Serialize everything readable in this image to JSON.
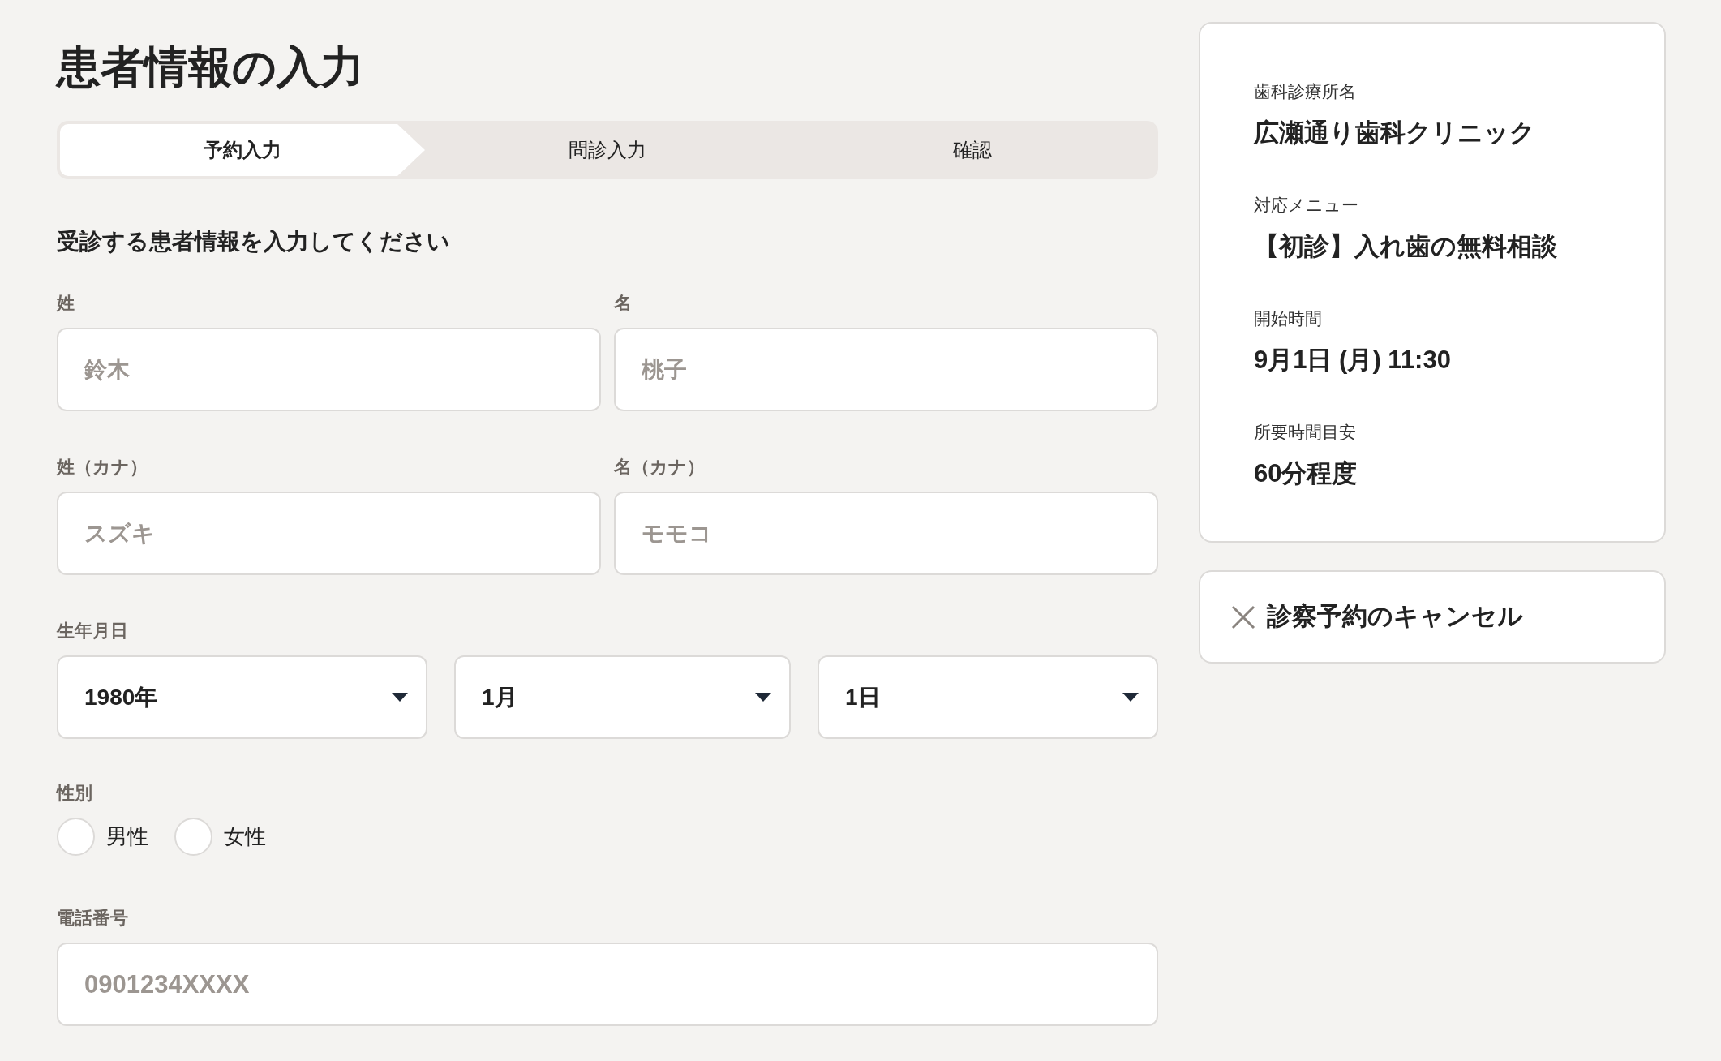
{
  "title": "患者情報の入力",
  "steps": [
    {
      "label": "予約入力",
      "selected": true
    },
    {
      "label": "問診入力",
      "selected": false
    },
    {
      "label": "確認",
      "selected": false
    }
  ],
  "section_heading": "受診する患者情報を入力してください",
  "name_fields": [
    {
      "label": "姓",
      "placeholder": "鈴木"
    },
    {
      "label": "名",
      "placeholder": "桃子"
    }
  ],
  "kana_fields": [
    {
      "label": "姓（カナ）",
      "placeholder": "スズキ"
    },
    {
      "label": "名（カナ）",
      "placeholder": "モモコ"
    }
  ],
  "birthdate": {
    "label": "生年月日",
    "selects": [
      {
        "value": "1980年"
      },
      {
        "value": "1月"
      },
      {
        "value": "1日"
      }
    ]
  },
  "gender": {
    "label": "性別",
    "options": [
      {
        "label": "男性",
        "selected": false
      },
      {
        "label": "女性",
        "selected": false
      }
    ]
  },
  "phone": {
    "label": "電話番号",
    "placeholder": "0901234XXXX"
  },
  "summary": [
    {
      "label": "歯科診療所名",
      "value": "広瀬通り歯科クリニック"
    },
    {
      "label": "対応メニュー",
      "value": "【初診】入れ歯の無料相談"
    },
    {
      "label": "開始時間",
      "value": "9月1日 (月) 11:30"
    },
    {
      "label": "所要時間目安",
      "value": "60分程度"
    }
  ],
  "cancel_button": "診察予約のキャンセル"
}
